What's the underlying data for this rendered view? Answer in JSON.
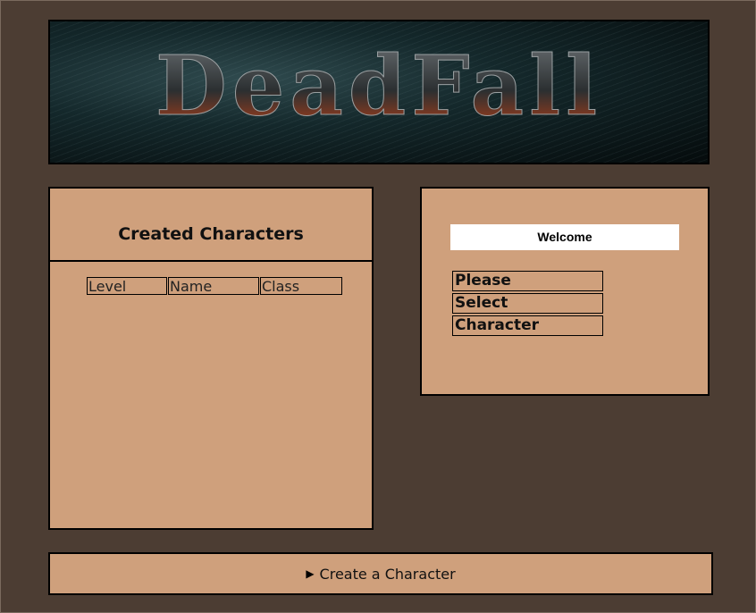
{
  "banner": {
    "logo_text": "DeadFall"
  },
  "characters": {
    "title": "Created Characters",
    "columns": [
      "Level",
      "Name",
      "Class"
    ]
  },
  "welcome": {
    "title": "Welcome",
    "message_lines": [
      "Please",
      "Select",
      "Character"
    ]
  },
  "create": {
    "label": "Create a Character",
    "toggle_icon": "disclosure-triangle-icon"
  },
  "colors": {
    "background": "#4c3d33",
    "panel": "#cfa07c",
    "border": "#000000"
  }
}
